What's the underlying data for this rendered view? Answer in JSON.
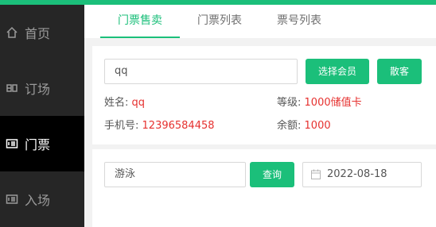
{
  "colors": {
    "accent": "#1bbf7a",
    "sidebar_bg": "#262626",
    "sidebar_active_bg": "#000000",
    "value_red": "#e6312f"
  },
  "sidebar": {
    "items": [
      {
        "label": "首页",
        "icon": "home-icon"
      },
      {
        "label": "订场",
        "icon": "court-booking-icon"
      },
      {
        "label": "门票",
        "icon": "ticket-icon",
        "active": true
      },
      {
        "label": "入场",
        "icon": "entry-icon"
      }
    ]
  },
  "tabs": [
    {
      "label": "门票售卖",
      "active": true
    },
    {
      "label": "门票列表"
    },
    {
      "label": "票号列表"
    }
  ],
  "member": {
    "search_value": "qq",
    "select_member_label": "选择会员",
    "guest_label": "散客",
    "name_label": "姓名:",
    "name_value": "qq",
    "level_label": "等级:",
    "level_value": "1000储值卡",
    "phone_label": "手机号:",
    "phone_value": "12396584458",
    "balance_label": "余额:",
    "balance_value": "1000"
  },
  "query": {
    "keyword_value": "游泳",
    "query_label": "查询",
    "date_value": "2022-08-18"
  }
}
